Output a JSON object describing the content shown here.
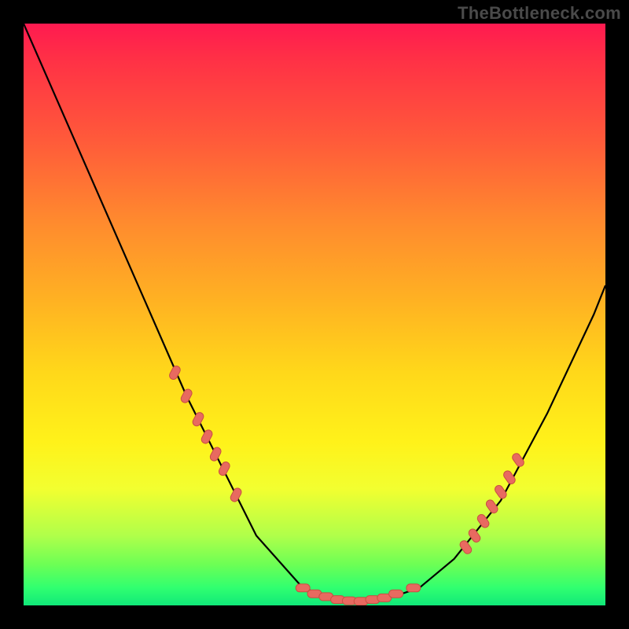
{
  "attribution": "TheBottleneck.com",
  "colors": {
    "bg": "#000000",
    "curve_color": "#000000",
    "marker_fill": "#e86a60",
    "marker_stroke": "#c94f42",
    "gradient_top": "#ff1a50",
    "gradient_bottom": "#10e879"
  },
  "chart_data": {
    "type": "line",
    "title": "",
    "xlabel": "",
    "ylabel": "",
    "xlim": [
      0,
      100
    ],
    "ylim": [
      0,
      100
    ],
    "grid": false,
    "legend": false,
    "series": [
      {
        "name": "bottleneck-curve",
        "x": [
          0,
          14,
          28,
          40,
          48,
          54,
          58,
          62,
          68,
          74,
          82,
          90,
          98,
          100
        ],
        "y": [
          100,
          68,
          36,
          12,
          3,
          1,
          0.5,
          1,
          3,
          8,
          18,
          33,
          50,
          55
        ]
      },
      {
        "name": "markers-left-descending",
        "x": [
          26,
          28,
          30,
          31.5,
          33,
          34.5,
          36.5
        ],
        "y": [
          40,
          36,
          32,
          29,
          26,
          23.5,
          19
        ]
      },
      {
        "name": "markers-bottom",
        "x": [
          48,
          50,
          52,
          54,
          56,
          58,
          60,
          62,
          64,
          67
        ],
        "y": [
          3,
          2,
          1.5,
          1,
          0.8,
          0.7,
          1,
          1.3,
          2,
          3
        ]
      },
      {
        "name": "markers-right-ascending",
        "x": [
          76,
          77.5,
          79,
          80.5,
          82,
          83.5,
          85
        ],
        "y": [
          10,
          12,
          14.5,
          17,
          19.5,
          22,
          25
        ]
      }
    ]
  }
}
